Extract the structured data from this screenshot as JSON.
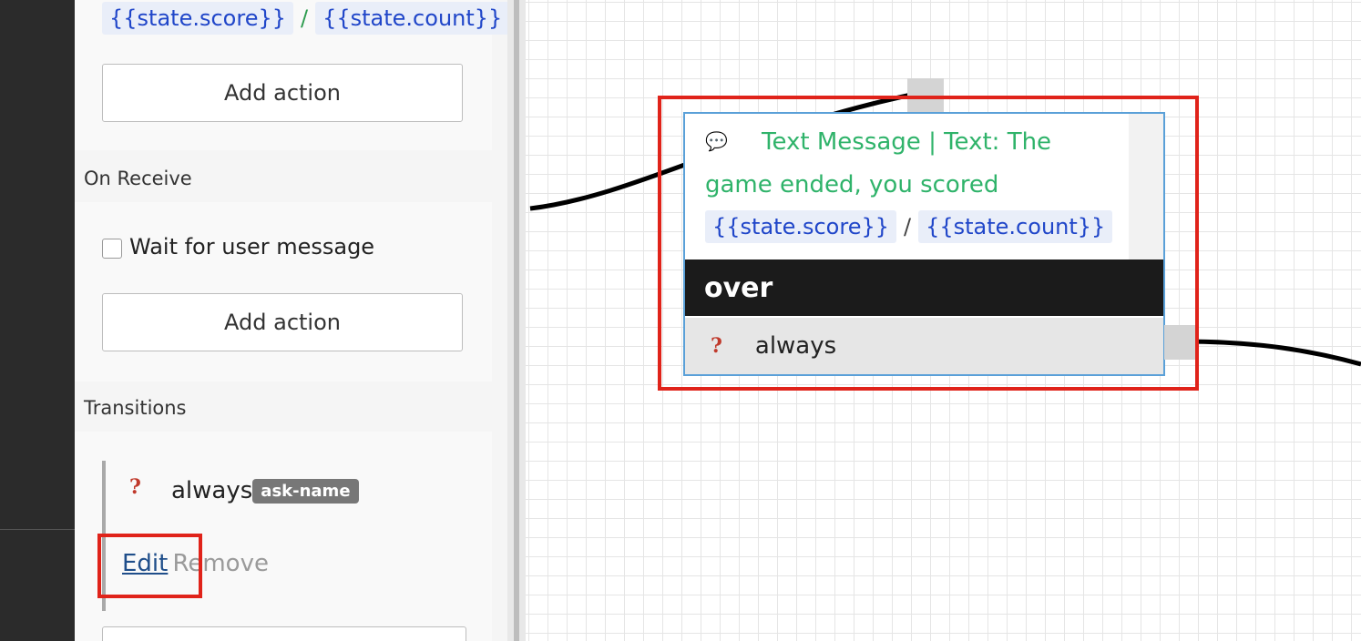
{
  "sidebar": {
    "top_expression": {
      "chip1": "{{state.score}}",
      "separator": "/",
      "chip2": "{{state.count}}"
    },
    "add_action_1": "Add action",
    "on_receive_title": "On Receive",
    "wait_label": "Wait for user message",
    "add_action_2": "Add action",
    "transitions_title": "Transitions",
    "transition": {
      "condition": "always",
      "target": "ask-name",
      "edit": "Edit",
      "remove": "Remove"
    }
  },
  "canvas": {
    "node": {
      "icon": "speech-bubble-icon",
      "message_line1": "Text Message | Text: The",
      "message_line2": "game ended, you scored",
      "chip1": "{{state.score}}",
      "separator": "/",
      "chip2": "{{state.count}}",
      "name": "over",
      "transition_label": "always"
    }
  },
  "colors": {
    "highlight": "#e0231a",
    "node_border": "#5aa0d8",
    "message_green": "#2fb36a",
    "chip_blue": "#2046c9",
    "node_header_bg": "#1b1b1b",
    "question_red": "#c0392b",
    "rail": "#2b2b2b"
  }
}
